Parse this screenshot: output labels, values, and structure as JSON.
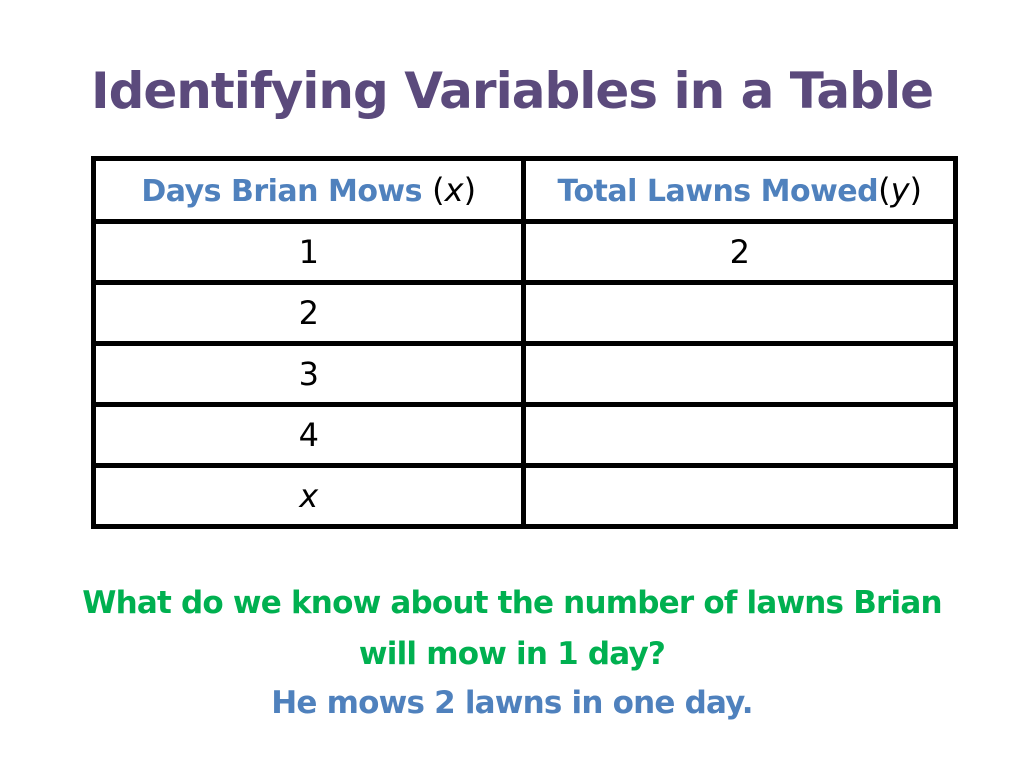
{
  "slide": {
    "title": "Identifying Variables in a Table",
    "colors": {
      "title": "#5b4a7c",
      "header": "#4f81bd",
      "question": "#00b050",
      "answer": "#4f81bd"
    }
  },
  "table": {
    "headers": [
      {
        "label": "Days Brian Mows",
        "open": " (",
        "var": "x",
        "close": ")"
      },
      {
        "label": "Total Lawns Mowed",
        "open": "(",
        "var": "y",
        "close": ")"
      }
    ],
    "rows": [
      {
        "x": "1",
        "y": "2"
      },
      {
        "x": "2",
        "y": ""
      },
      {
        "x": "3",
        "y": ""
      },
      {
        "x": "4",
        "y": ""
      },
      {
        "x": "x",
        "y": ""
      }
    ]
  },
  "question": {
    "line1": "What do we know about the number of lawns Brian",
    "line2": "will mow in 1 day?"
  },
  "answer": "He mows 2 lawns in one day."
}
